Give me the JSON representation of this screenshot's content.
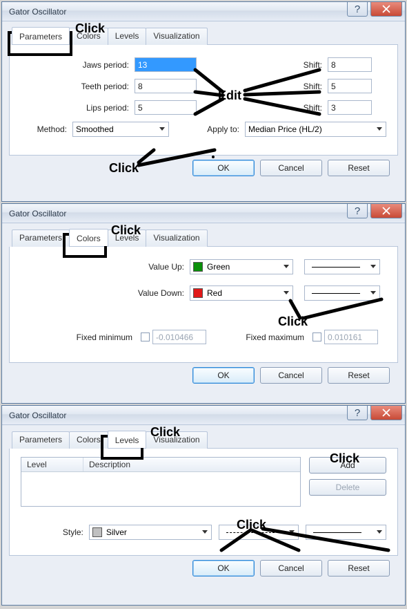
{
  "annotations": {
    "click": "Click",
    "edit": "Edit"
  },
  "buttons": {
    "ok": "OK",
    "cancel": "Cancel",
    "reset": "Reset",
    "add": "Add",
    "delete": "Delete"
  },
  "tabs": {
    "parameters": "Parameters",
    "colors": "Colors",
    "levels": "Levels",
    "visualization": "Visualization"
  },
  "d1": {
    "title": "Gator Oscillator",
    "jaws_label": "Jaws period:",
    "jaws_value": "13",
    "jaws_shift_label": "Shift:",
    "jaws_shift": "8",
    "teeth_label": "Teeth period:",
    "teeth_value": "8",
    "teeth_shift_label": "Shift:",
    "teeth_shift": "5",
    "lips_label": "Lips period:",
    "lips_value": "5",
    "lips_shift_label": "Shift:",
    "lips_shift": "3",
    "method_label": "Method:",
    "method_value": "Smoothed",
    "apply_label": "Apply to:",
    "apply_value": "Median Price (HL/2)"
  },
  "d2": {
    "title": "Gator Oscillator",
    "valueup_label": "Value Up:",
    "valueup_color": "Green",
    "valueup_hex": "#0a8f0a",
    "valuedown_label": "Value Down:",
    "valuedown_color": "Red",
    "valuedown_hex": "#e11919",
    "fixedmin_label": "Fixed minimum",
    "fixedmin_value": "-0.010466",
    "fixedmax_label": "Fixed maximum",
    "fixedmax_value": "0.010161"
  },
  "d3": {
    "title": "Gator Oscillator",
    "col_level": "Level",
    "col_desc": "Description",
    "style_label": "Style:",
    "style_color": "Silver",
    "style_hex": "#c0c0c0"
  }
}
